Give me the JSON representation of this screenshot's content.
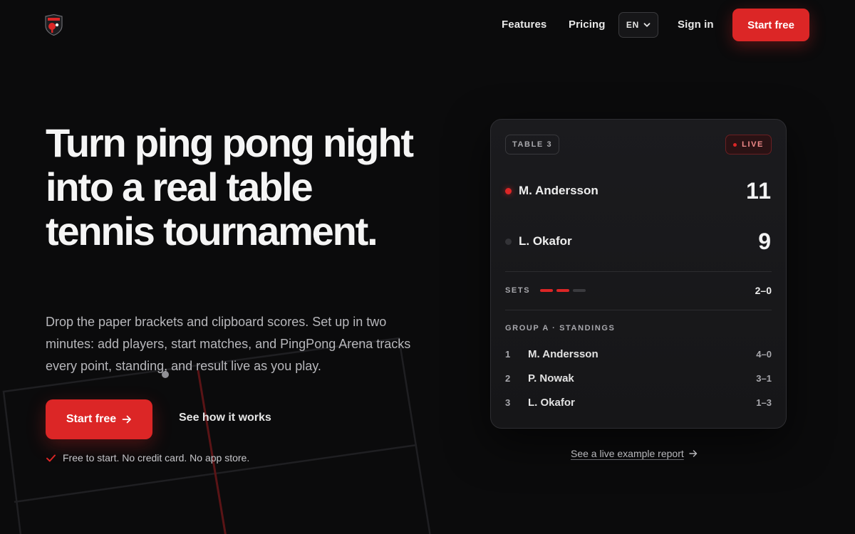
{
  "header": {
    "logo_icon": "ping-pong-shield-icon",
    "nav": {
      "features": "Features",
      "pricing": "Pricing",
      "language": "EN",
      "sign_in": "Sign in",
      "cta": "Start free"
    }
  },
  "hero": {
    "title": "Turn ping pong night into a real table tennis tournament.",
    "subtitle": "Drop the paper brackets and clipboard scores. Set up in two minutes: add players, start matches, and PingPong Arena tracks every point, standing, and result live as you play.",
    "primary_cta": "Start free",
    "secondary_cta": "See how it works",
    "assurance": "Free to start. No credit card. No app store."
  },
  "scoreboard": {
    "table_label": "TABLE 3",
    "live_label": "LIVE",
    "players": [
      {
        "name": "M. Andersson",
        "score": "11",
        "serving": true
      },
      {
        "name": "L. Okafor",
        "score": "9",
        "serving": false
      }
    ],
    "sets_label": "SETS",
    "sets": [
      "won",
      "won",
      "pending"
    ],
    "sets_score": "2–0",
    "standings_title": "GROUP A · STANDINGS",
    "standings": [
      {
        "rank": "1",
        "name": "M. Andersson",
        "record": "4–0"
      },
      {
        "rank": "2",
        "name": "P. Nowak",
        "record": "3–1"
      },
      {
        "rank": "3",
        "name": "L. Okafor",
        "record": "1–3"
      }
    ]
  },
  "report_link": "See a live example report",
  "colors": {
    "accent": "#dc2626",
    "background": "#0b0b0c",
    "card": "#1b1b1e"
  }
}
